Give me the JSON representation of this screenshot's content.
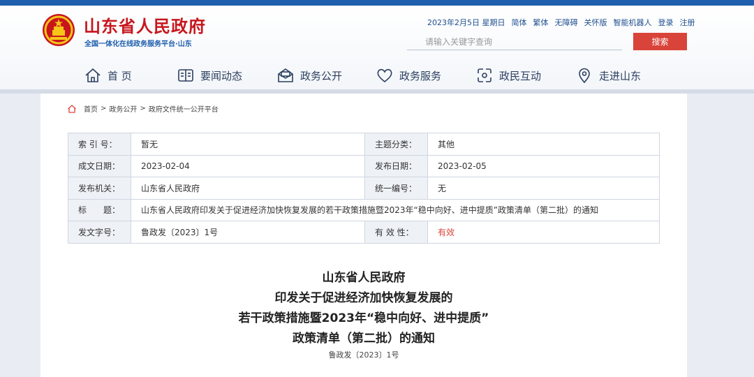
{
  "header": {
    "title": "山东省人民政府",
    "subtitle": "全国一体化在线政务服务平台·山东",
    "emblem_icon": "national-emblem-icon"
  },
  "utility_bar": {
    "date": "2023年2月5日 星期日",
    "links": [
      "简体",
      "繁体",
      "无障碍",
      "关怀版",
      "智能机器人",
      "登录",
      "注册"
    ]
  },
  "search": {
    "placeholder": "请输入关键字查询",
    "button_label": "搜索"
  },
  "nav": {
    "items": [
      {
        "label": "首 页",
        "icon": "home-icon"
      },
      {
        "label": "要闻动态",
        "icon": "news-book-icon"
      },
      {
        "label": "政务公开",
        "icon": "open-mail-icon"
      },
      {
        "label": "政务服务",
        "icon": "heart-icon"
      },
      {
        "label": "政民互动",
        "icon": "interaction-icon"
      },
      {
        "label": "走进山东",
        "icon": "location-icon"
      }
    ]
  },
  "breadcrumb": {
    "icon": "home-icon",
    "items": [
      "首页",
      "政务公开",
      "政府文件统一公开平台"
    ],
    "separator": ">"
  },
  "meta": {
    "rows": [
      {
        "l1": "索 引 号：",
        "v1": "暂无",
        "l2": "主题分类：",
        "v2": "其他"
      },
      {
        "l1": "成文日期：",
        "v1": "2023-02-04",
        "l2": "发布日期：",
        "v2": "2023-02-05"
      },
      {
        "l1": "发布机关：",
        "v1": "山东省人民政府",
        "l2": "统一编号：",
        "v2": "无"
      },
      {
        "l1": "标　　题：",
        "v1": "山东省人民政府印发关于促进经济加快恢复发展的若干政策措施暨2023年“稳中向好、进中提质”政策清单（第二批）的通知"
      },
      {
        "l1": "发文字号：",
        "v1": "鲁政发〔2023〕1号",
        "l2": "有 效 性：",
        "v2": "有效"
      }
    ]
  },
  "document": {
    "title_lines": [
      "山东省人民政府",
      "印发关于促进经济加快恢复发展的",
      "若干政策措施暨2023年“稳中向好、进中提质”",
      "政策清单（第二批）的通知"
    ],
    "doc_number": "鲁政发〔2023〕1号"
  },
  "colors": {
    "brand_blue": "#1f5fad",
    "brand_red": "#c8161d",
    "search_button": "#d9443a"
  }
}
